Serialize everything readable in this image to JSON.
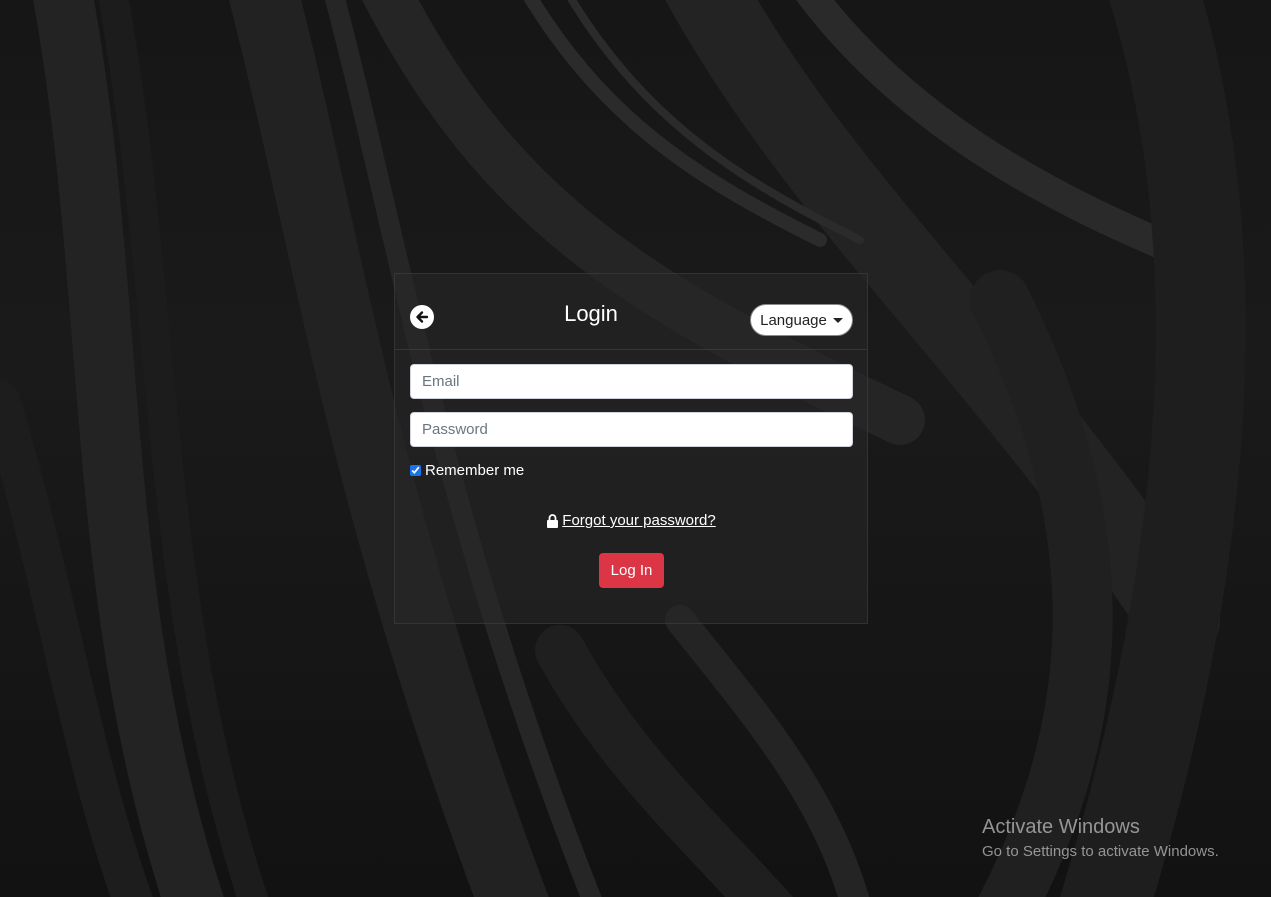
{
  "login": {
    "title": "Login",
    "language_label": "Language",
    "email_placeholder": "Email",
    "password_placeholder": "Password",
    "remember_label": "Remember me",
    "remember_checked": true,
    "forgot_label": "Forgot your password?",
    "submit_label": "Log In"
  },
  "icons": {
    "back": "arrow-left-circle-icon",
    "lock": "lock-icon",
    "caret": "caret-down-icon"
  },
  "colors": {
    "primary_button": "#dc3545",
    "background": "#141414"
  },
  "watermark": {
    "title": "Activate Windows",
    "subtitle": "Go to Settings to activate Windows."
  }
}
